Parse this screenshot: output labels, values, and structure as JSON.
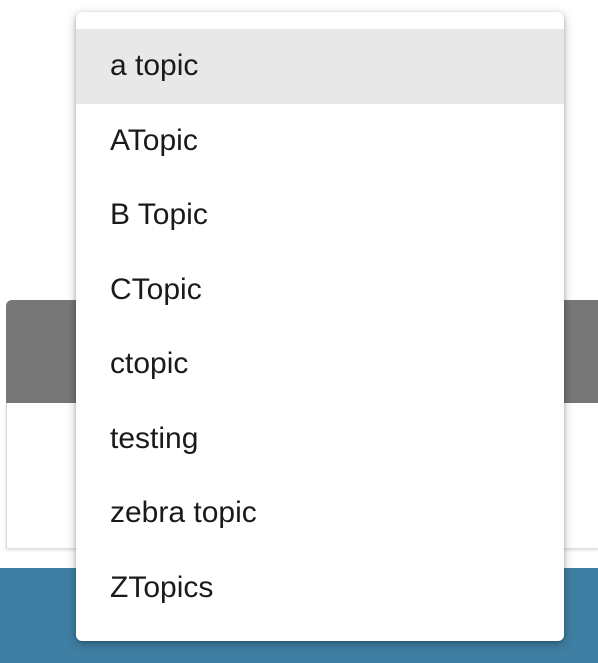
{
  "dropdown": {
    "items": [
      {
        "label": "a topic",
        "highlighted": true
      },
      {
        "label": "ATopic",
        "highlighted": false
      },
      {
        "label": "B Topic",
        "highlighted": false
      },
      {
        "label": "CTopic",
        "highlighted": false
      },
      {
        "label": "ctopic",
        "highlighted": false
      },
      {
        "label": "testing",
        "highlighted": false
      },
      {
        "label": "zebra topic",
        "highlighted": false
      },
      {
        "label": "ZTopics",
        "highlighted": false
      }
    ]
  },
  "colors": {
    "highlight": "#e8e8e8",
    "card_header": "#777777",
    "footer_bar": "#3f7fa3",
    "menu_background": "#ffffff",
    "text": "#1a1a1a"
  }
}
